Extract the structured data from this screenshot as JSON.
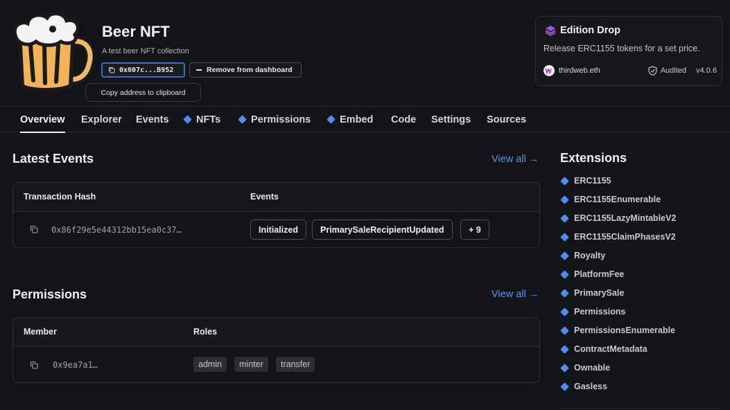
{
  "contract": {
    "name": "Beer NFT",
    "description": "A test beer NFT collection",
    "address_short": "0x607c...B952",
    "remove_label": "Remove from dashboard",
    "tooltip": "Copy address to clipboard"
  },
  "card": {
    "title": "Edition Drop",
    "description": "Release ERC1155 tokens for a set price.",
    "author": "thirdweb.eth",
    "audited": "Audited",
    "version": "v4.0.6"
  },
  "tabs": [
    {
      "label": "Overview",
      "icon": "",
      "active": true
    },
    {
      "label": "Explorer",
      "icon": "",
      "active": false
    },
    {
      "label": "Events",
      "icon": "",
      "active": false
    },
    {
      "label": "NFTs",
      "icon": "diamond-icon",
      "active": false
    },
    {
      "label": "Permissions",
      "icon": "diamond-icon",
      "active": false
    },
    {
      "label": "Embed",
      "icon": "diamond-icon",
      "active": false
    },
    {
      "label": "Code",
      "icon": "",
      "active": false
    },
    {
      "label": "Settings",
      "icon": "",
      "active": false
    },
    {
      "label": "Sources",
      "icon": "",
      "active": false
    }
  ],
  "latest_events": {
    "title": "Latest Events",
    "view_all": "View all →",
    "columns": [
      "Transaction Hash",
      "Events"
    ],
    "rows": [
      {
        "hash": "0x86f29e5e44312bb15ea0c37…",
        "events": [
          "Initialized",
          "PrimarySaleRecipientUpdated",
          "+ 9"
        ]
      }
    ]
  },
  "permissions": {
    "title": "Permissions",
    "view_all": "View all →",
    "columns": [
      "Member",
      "Roles"
    ],
    "rows": [
      {
        "member": "0x9ea7a1…",
        "roles": [
          "admin",
          "minter",
          "transfer"
        ]
      }
    ]
  },
  "extensions": {
    "title": "Extensions",
    "items": [
      "ERC1155",
      "ERC1155Enumerable",
      "ERC1155LazyMintableV2",
      "ERC1155ClaimPhasesV2",
      "Royalty",
      "PlatformFee",
      "PrimarySale",
      "Permissions",
      "PermissionsEnumerable",
      "ContractMetadata",
      "Ownable",
      "Gasless"
    ]
  },
  "colors": {
    "accent": "#5a92ef",
    "diamond": "#4c8df6",
    "background": "#131417"
  }
}
